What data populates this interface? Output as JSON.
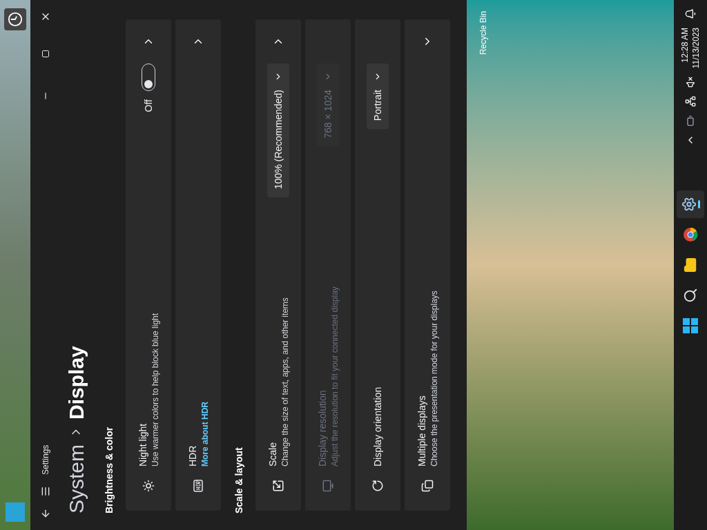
{
  "window": {
    "title": "Settings",
    "breadcrumb": [
      "System",
      "Display"
    ]
  },
  "sections": [
    {
      "title": "Brightness & color",
      "cards": [
        {
          "kind": "toggle",
          "title": "Night light",
          "description": "Use warmer colors to help block blue light",
          "state_label": "Off",
          "on": false,
          "opens_page": true
        },
        {
          "kind": "link",
          "title": "HDR",
          "link": "More about HDR",
          "opens_page": true
        }
      ]
    },
    {
      "title": "Scale & layout",
      "cards": [
        {
          "kind": "dropdown",
          "title": "Scale",
          "description": "Change the size of text, apps, and other items",
          "value": "100% (Recommended)",
          "disabled": false,
          "opens_page": true
        },
        {
          "kind": "dropdown",
          "title": "Display resolution",
          "description": "Adjust the resolution to fit your connected display",
          "value": "768 × 1024",
          "disabled": true
        },
        {
          "kind": "dropdown",
          "title": "Display orientation",
          "value": "Portrait",
          "disabled": false
        },
        {
          "kind": "nav",
          "title": "Multiple displays",
          "description": "Choose the presentation mode for your displays",
          "expanded": false
        }
      ]
    }
  ],
  "desktop": {
    "label": "Recycle Bin"
  },
  "taskbar": {
    "apps": [
      {
        "kind": "start",
        "selected": false
      },
      {
        "kind": "search",
        "selected": false
      },
      {
        "kind": "files",
        "selected": false
      },
      {
        "kind": "browser",
        "selected": false
      },
      {
        "kind": "settings",
        "selected": true
      }
    ],
    "time": "12:28 AM",
    "date": "11/13/2023"
  }
}
